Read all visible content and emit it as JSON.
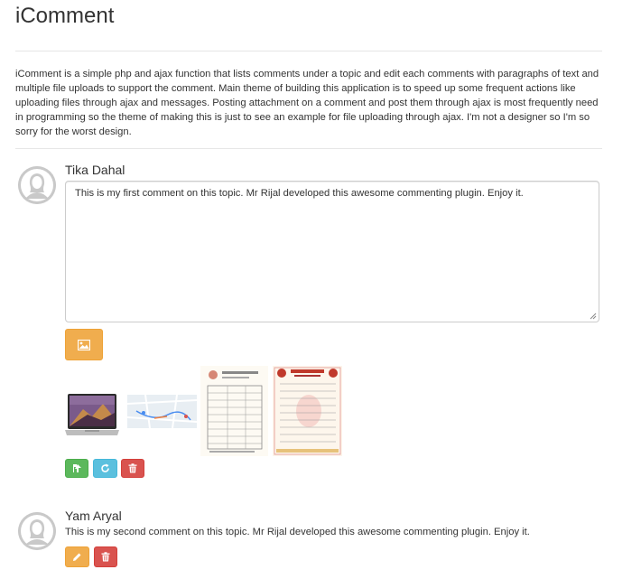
{
  "page": {
    "title": "iComment",
    "intro": "iComment is a simple php and ajax function that lists comments under a topic and edit each comments with paragraphs of text and multiple file uploads to support the comment. Main theme of building this application is to speed up some frequent actions like uploading files through ajax and messages. Posting attachment on a comment and post them through ajax is most frequently need in programming so the theme of making this is just to see an example for file uploading through ajax. I'm not a designer so I'm so sorry for the worst design."
  },
  "comments": [
    {
      "author": "Tika Dahal",
      "text": "This is my first comment on this topic. Mr Rijal developed this awesome commenting plugin. Enjoy it.",
      "upload_icon": "image-icon",
      "attachments": [
        {
          "name": "laptop-image"
        },
        {
          "name": "map-image"
        },
        {
          "name": "document-image"
        },
        {
          "name": "certificate-image"
        }
      ],
      "actions": [
        "save-icon",
        "refresh-icon",
        "trash-icon"
      ]
    },
    {
      "author": "Yam Aryal",
      "text": "This is my second comment on this topic. Mr Rijal developed this awesome commenting plugin. Enjoy it.",
      "actions": [
        "pencil-icon",
        "trash-icon"
      ]
    }
  ],
  "colors": {
    "warning": "#f0ad4e",
    "success": "#5cb85c",
    "info": "#5bc0de",
    "danger": "#d9534f",
    "avatar": "#c9c9c9"
  }
}
